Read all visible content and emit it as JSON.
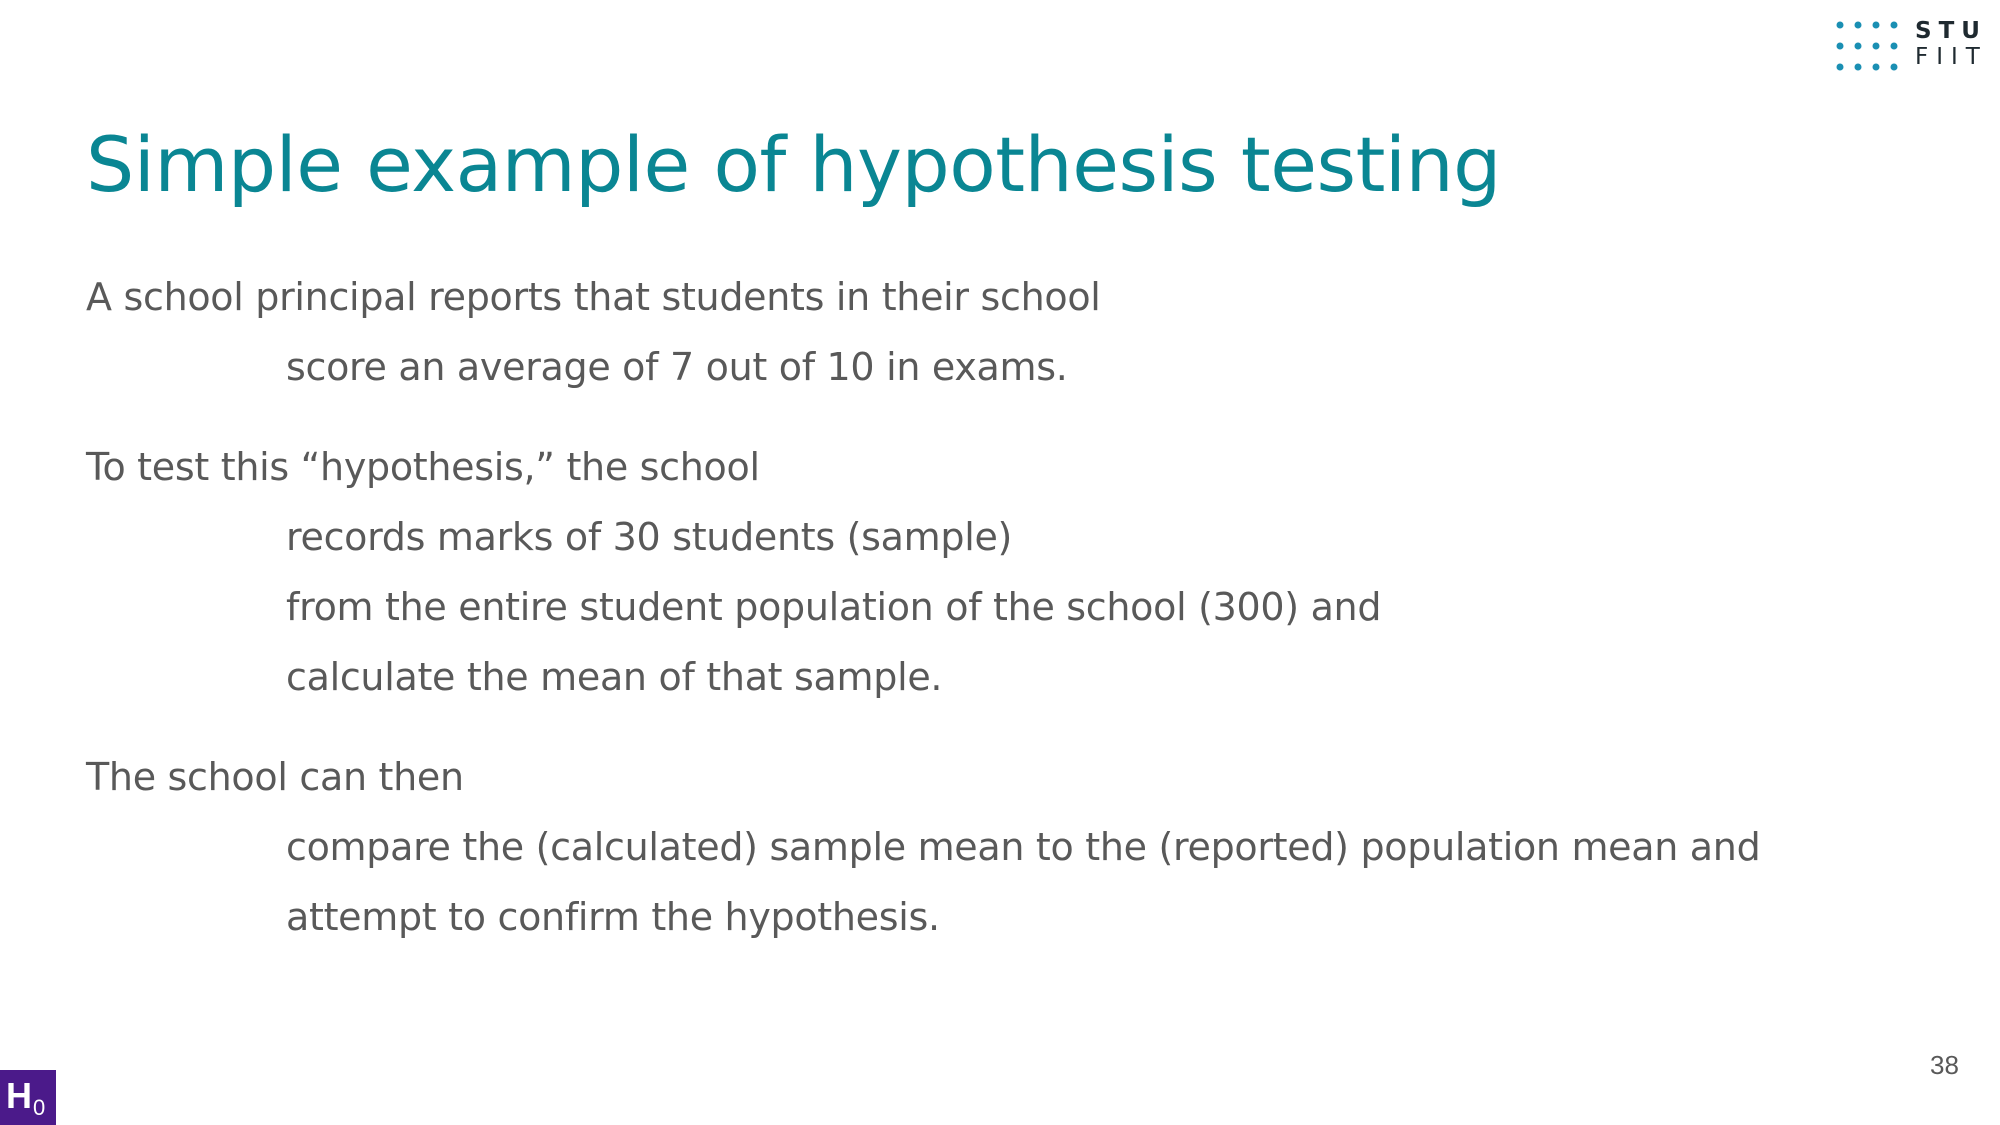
{
  "slide": {
    "title": "Simple example of hypothesis testing",
    "page_number": "38"
  },
  "logo": {
    "line1": "STU",
    "line2": "FIIT",
    "accent_color": "#1a8fb3"
  },
  "badge": {
    "letter": "H",
    "subscript": "0",
    "color": "#4b1a8a"
  },
  "paragraphs": [
    {
      "lead": "A school principal reports that students in their school",
      "indented": [
        "score an average of 7 out of 10 in exams."
      ]
    },
    {
      "lead": "To test this “hypothesis,” the school",
      "indented": [
        "records marks of 30 students (sample)",
        "from the entire student population of the school (300) and",
        "calculate the mean of that sample."
      ]
    },
    {
      "lead": "The school can then",
      "indented": [
        "compare the (calculated) sample mean to the (reported) population mean and",
        "attempt to confirm the hypothesis."
      ]
    }
  ],
  "colors": {
    "title": "#0a8693",
    "body_text": "#595959"
  }
}
